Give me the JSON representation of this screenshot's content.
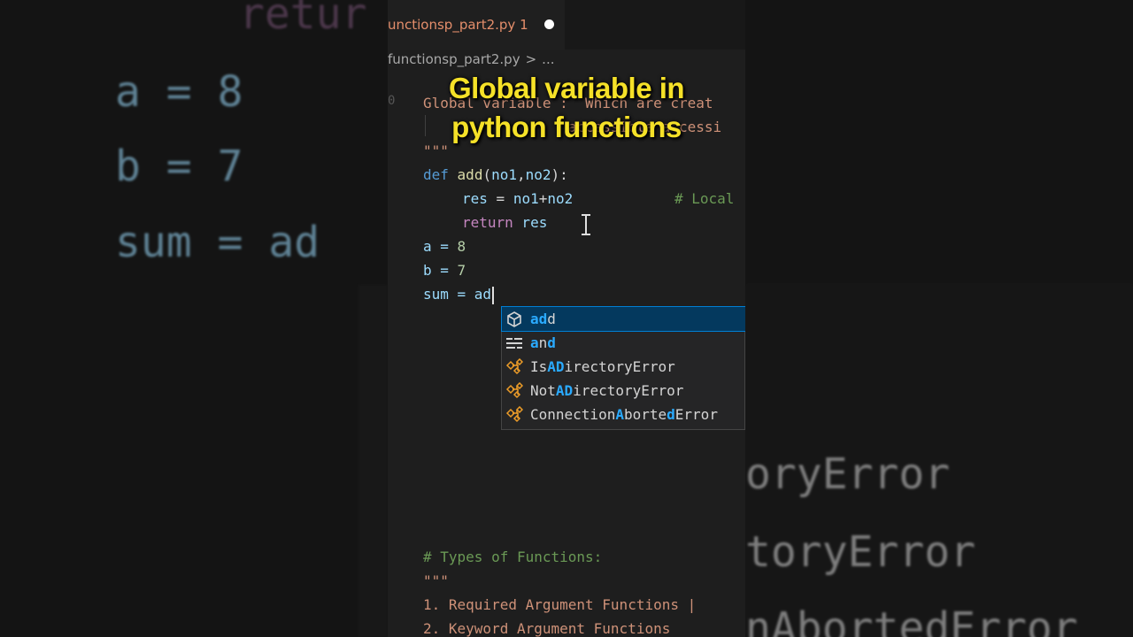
{
  "caption": {
    "line1": "Global variable in",
    "line2": "python functions"
  },
  "tab": {
    "filename": "unctionsp_part2.py",
    "problems": "1"
  },
  "breadcrumb": {
    "file": "functionsp_part2.py",
    "separator": ">",
    "more": "..."
  },
  "code": {
    "docstring_1": "Global variable :  Which are creat",
    "docstring_2": "                 accessible accessi",
    "docstring_end": "\"\"\"",
    "def_kw": "def",
    "def_name": "add",
    "def_open": "(",
    "def_p1": "no1",
    "def_comma": ",",
    "def_p2": "no2",
    "def_close": "):",
    "res_var": "res",
    "res_eq": " = ",
    "res_a": "no1",
    "res_plus": "+",
    "res_b": "no2",
    "res_comment": "# Local",
    "return_kw": "return",
    "return_val": " res",
    "a_line": "a = ",
    "a_val": "8",
    "b_line": "b = ",
    "b_val": "7",
    "sum_line": "sum = ad",
    "types_comment": "# Types of Functions:",
    "types_doc": "\"\"\"",
    "list_1": "1. Required Argument Functions | ",
    "list_2": "2. Keyword Argument Functions"
  },
  "suggestions": [
    {
      "icon": "method-icon",
      "pre": "",
      "hl1": "ad",
      "mid": "",
      "hl2": "",
      "post": "d",
      "full": "add"
    },
    {
      "icon": "keyword-icon",
      "pre": "",
      "hl1": "a",
      "mid": "n",
      "hl2": "d",
      "post": "",
      "full": "and"
    },
    {
      "icon": "class-icon",
      "pre": "Is",
      "hl1": "AD",
      "mid": "irectoryError",
      "hl2": "",
      "post": "",
      "full": "IsADirectoryError"
    },
    {
      "icon": "class-icon",
      "pre": "Not",
      "hl1": "AD",
      "mid": "irectoryError",
      "hl2": "",
      "post": "",
      "full": "NotADirectoryError"
    },
    {
      "icon": "class-icon",
      "pre": "Connection",
      "hl1": "A",
      "mid": "borte",
      "hl2": "d",
      "post": "Error",
      "full": "ConnectionAbortedError"
    }
  ],
  "background_left": {
    "line_return": "retur",
    "line_a": "a = 8",
    "line_b": "b = 7",
    "line_sum": "sum = ad"
  },
  "background_right": {
    "line_1": "oryError",
    "line_2": "toryError",
    "line_3": "nAbortedError"
  },
  "colors": {
    "accent": "#007fd4",
    "caption": "#f5e128",
    "match_highlight": "#2aaaff"
  }
}
